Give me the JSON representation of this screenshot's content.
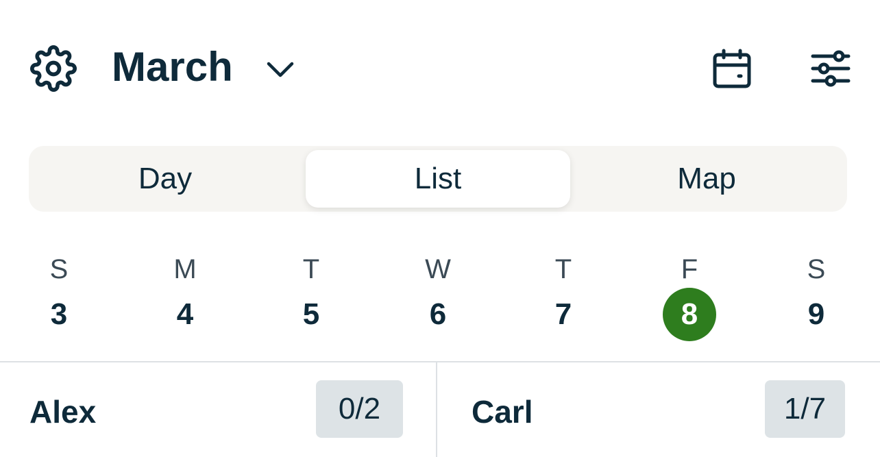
{
  "header": {
    "month": "March",
    "settings_icon": "gear-icon",
    "chevron_icon": "chevron-down-icon",
    "calendar_icon": "calendar-icon",
    "filter_icon": "sliders-icon"
  },
  "view_tabs": [
    {
      "label": "Day",
      "selected": false
    },
    {
      "label": "List",
      "selected": true
    },
    {
      "label": "Map",
      "selected": false
    }
  ],
  "week": [
    {
      "letter": "S",
      "date": "3",
      "selected": false
    },
    {
      "letter": "M",
      "date": "4",
      "selected": false
    },
    {
      "letter": "T",
      "date": "5",
      "selected": false
    },
    {
      "letter": "W",
      "date": "6",
      "selected": false
    },
    {
      "letter": "T",
      "date": "7",
      "selected": false
    },
    {
      "letter": "F",
      "date": "8",
      "selected": true
    },
    {
      "letter": "S",
      "date": "9",
      "selected": false
    }
  ],
  "people": [
    {
      "name": "Alex",
      "count": "0/2"
    },
    {
      "name": "Carl",
      "count": "1/7"
    }
  ],
  "colors": {
    "text": "#0e2a3a",
    "accent_selected_day": "#2e7d1e",
    "segment_bg": "#f6f5f2",
    "badge_bg": "#dde3e6"
  }
}
